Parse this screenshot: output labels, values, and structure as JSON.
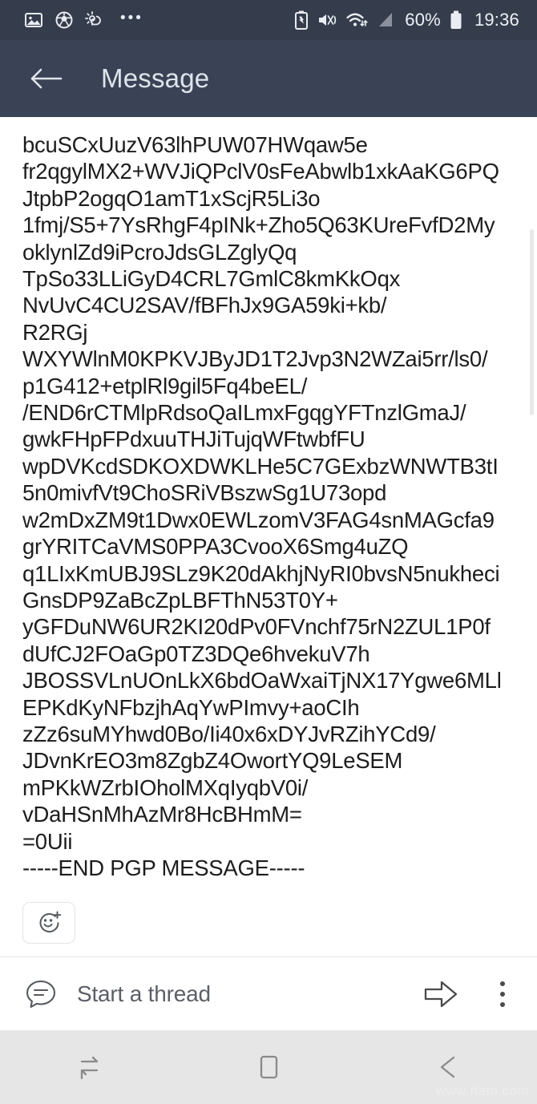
{
  "status_bar": {
    "left_icons": [
      "image-icon",
      "soccer-ball-icon",
      "weather-icon",
      "more-dots-icon"
    ],
    "more_dots": "•••",
    "right_icons": [
      "battery-saver-icon",
      "mute-vibrate-icon",
      "wifi-icon",
      "signal-icon",
      "battery-icon"
    ],
    "battery_percent": "60%",
    "time": "19:36",
    "background": "#353d4d",
    "foreground": "#e9ecf2"
  },
  "header": {
    "back_label": "back-arrow",
    "title": "Message",
    "background": "#3a4355",
    "foreground": "#dfe4ec"
  },
  "message": {
    "body": "bcuSCxUuzV63lhPUW07HWqaw5e\nfr2qgylMX2+WVJiQPclV0sFeAbwlb1xkAaKG6PQ\nJtpbP2ogqO1amT1xScjR5Li3o\n1fmj/S5+7YsRhgF4pINk+Zho5Q63KUreFvfD2My\noklynlZd9iPcroJdsGLZglyQq\nTpSo33LLiGyD4CRL7GmlC8kmKkOqx\nNvUvC4CU2SAV/fBFhJx9GA59ki+kb/\nR2RGj\nWXYWlnM0KPKVJByJD1T2Jvp3N2WZai5rr/ls0/\np1G412+etplRl9gil5Fq4beEL/\n/END6rCTMlpRdsoQaILmxFgqgYFTnzlGmaJ/\ngwkFHpFPdxuuTHJiTujqWFtwbfFU\nwpDVKcdSDKOXDWKLHe5C7GExbzWNWTB3tI\n5n0mivfVt9ChoSRiVBszwSg1U73opd\nw2mDxZM9t1Dwx0EWLzomV3FAG4snMAGcfa9\ngrYRITCaVMS0PPA3CvooX6Smg4uZQ\nq1LIxKmUBJ9SLz9K20dAkhjNyRI0bvsN5nukheci\nGnsDP9ZaBcZpLBFThN53T0Y+\nyGFDuNW6UR2KI20dPv0FVnchf75rN2ZUL1P0f\ndUfCJ2FOaGp0TZ3DQe6hvekuV7h\nJBOSSVLnUOnLkX6bdOaWxaiTjNX17Ygwe6MLl\nEPKdKyNFbzjhAqYwPImvy+aoCIh\nzZz6suMYhwd0Bo/Ii40x6xDYJvRZihYCd9/\nJDvnKrEO3m8ZgbZ4OwortYQ9LeSEM\nmPKkWZrbIOholMXqIyqbV0i/\nvDaHSnMhAzMr8HcBHmM=\n=0Uii\n-----END PGP MESSAGE-----",
    "text_color": "#1d1d1d"
  },
  "reaction": {
    "icon": "add-reaction-icon",
    "label": ""
  },
  "thread_bar": {
    "icon": "thread-icon",
    "placeholder": "Start a thread",
    "send_icon": "send-arrow-icon",
    "overflow_icon": "overflow-menu-icon"
  },
  "nav_bar": {
    "items": [
      "recents-icon",
      "home-icon",
      "back-icon"
    ],
    "background": "#e6e6e6"
  },
  "watermark": {
    "text": "www.ffam.com"
  }
}
